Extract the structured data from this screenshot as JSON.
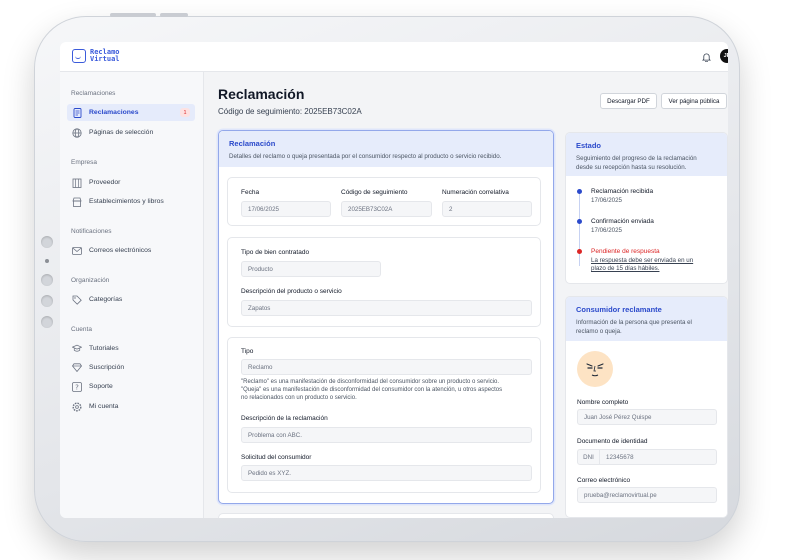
{
  "app": {
    "logo_line1": "Reclamo",
    "logo_line2": "Virtual",
    "user_initials": "JP"
  },
  "sidebar": {
    "sections": [
      {
        "title": "Reclamaciones",
        "items": [
          {
            "label": "Reclamaciones",
            "icon": "document-icon",
            "badge": "1",
            "active": true
          },
          {
            "label": "Páginas de selección",
            "icon": "globe-icon"
          }
        ]
      },
      {
        "title": "Empresa",
        "items": [
          {
            "label": "Proveedor",
            "icon": "building-icon"
          },
          {
            "label": "Establecimientos y libros",
            "icon": "store-icon"
          }
        ]
      },
      {
        "title": "Notificaciones",
        "items": [
          {
            "label": "Correos electrónicos",
            "icon": "mail-icon"
          }
        ]
      },
      {
        "title": "Organización",
        "items": [
          {
            "label": "Categorías",
            "icon": "tag-icon"
          }
        ]
      },
      {
        "title": "Cuenta",
        "items": [
          {
            "label": "Tutoriales",
            "icon": "graduation-cap-icon"
          },
          {
            "label": "Suscripción",
            "icon": "diamond-icon"
          },
          {
            "label": "Soporte",
            "icon": "help-icon"
          },
          {
            "label": "Mi cuenta",
            "icon": "gear-icon"
          }
        ]
      }
    ]
  },
  "header": {
    "title": "Reclamación",
    "tracking": "Código de seguimiento: 2025EB73C02A",
    "btn_pdf": "Descargar PDF",
    "btn_public": "Ver página pública"
  },
  "claim": {
    "title": "Reclamación",
    "desc": "Detalles del reclamo o queja presentada por el consumidor respecto al producto o servicio recibido.",
    "fecha_label": "Fecha",
    "fecha_value": "17/06/2025",
    "codigo_label": "Código de seguimiento",
    "codigo_value": "2025EB73C02A",
    "numeracion_label": "Numeración correlativa",
    "numeracion_value": "2",
    "tipo_bien_label": "Tipo de bien contratado",
    "tipo_bien_value": "Producto",
    "desc_prod_label": "Descripción del producto o servicio",
    "desc_prod_value": "Zapatos",
    "tipo_label": "Tipo",
    "tipo_value": "Reclamo",
    "help1": "\"Reclamo\" es una manifestación de disconformidad del consumidor sobre un producto o servicio.",
    "help2": "\"Queja\" es una manifestación de disconformidad del consumidor con la atención, u otros aspectos",
    "help3": "no relacionados con un producto o servicio.",
    "desc_recl_label": "Descripción de la reclamación",
    "desc_recl_value": "Problema con ABC.",
    "solicitud_label": "Solicitud del consumidor",
    "solicitud_value": "Pedido es XYZ."
  },
  "status": {
    "title": "Estado",
    "desc1": "Seguimiento del progreso de la reclamación",
    "desc2": "desde su recepción hasta su resolución.",
    "steps": [
      {
        "title": "Reclamación recibida",
        "date": "17/06/2025",
        "color": "#2b4acb"
      },
      {
        "title": "Confirmación enviada",
        "date": "17/06/2025",
        "color": "#2b4acb"
      },
      {
        "title": "Pendiente de respuesta",
        "note1": "La respuesta debe ser enviada en un",
        "note2": "plazo de 15 días hábiles.",
        "color": "#dc2626"
      }
    ]
  },
  "consumer": {
    "title": "Consumidor reclamante",
    "desc1": "Información de la persona que presenta el",
    "desc2": "reclamo o queja.",
    "name_label": "Nombre completo",
    "name_value": "Juan José Pérez Quispe",
    "doc_label": "Documento de identidad",
    "doc_type": "DNI",
    "doc_value": "12345678",
    "email_label": "Correo electrónico",
    "email_value": "prueba@reclamovirtual.pe"
  }
}
